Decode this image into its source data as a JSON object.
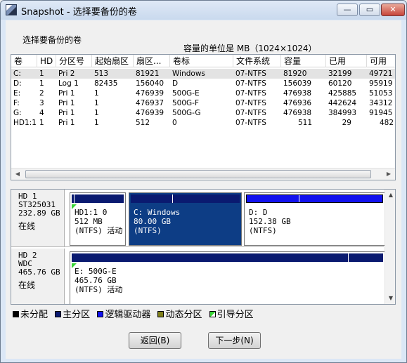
{
  "window": {
    "title": "Snapshot - 选择要备份的卷",
    "min_glyph": "—",
    "max_glyph": "▭",
    "close_glyph": "✕"
  },
  "labels": {
    "select_volume": "选择要备份的卷",
    "unit_note": "容量的单位是 MB（1024×1024）"
  },
  "columns": [
    "卷",
    "HD",
    "分区号",
    "起始扇区",
    "扇区...",
    "卷标",
    "文件系统",
    "容量",
    "已用",
    "可用"
  ],
  "rows": [
    {
      "vol": "C:",
      "hd": "1",
      "pno": "Pri  2",
      "start": "513",
      "sectors": "81921",
      "label": "Windows",
      "fs": "07-NTFS",
      "cap": "81920",
      "used": "32199",
      "free": "49721"
    },
    {
      "vol": "D:",
      "hd": "1",
      "pno": "Log  1",
      "start": "82435",
      "sectors": "156040",
      "label": "D",
      "fs": "07-NTFS",
      "cap": "156039",
      "used": "60120",
      "free": "95919"
    },
    {
      "vol": "E:",
      "hd": "2",
      "pno": "Pri  1",
      "start": "1",
      "sectors": "476939",
      "label": "500G-E",
      "fs": "07-NTFS",
      "cap": "476938",
      "used": "425885",
      "free": "51053"
    },
    {
      "vol": "F:",
      "hd": "3",
      "pno": "Pri  1",
      "start": "1",
      "sectors": "476937",
      "label": "500G-F",
      "fs": "07-NTFS",
      "cap": "476936",
      "used": "442624",
      "free": "34312"
    },
    {
      "vol": "G:",
      "hd": "4",
      "pno": "Pri  1",
      "start": "1",
      "sectors": "476939",
      "label": "500G-G",
      "fs": "07-NTFS",
      "cap": "476938",
      "used": "384993",
      "free": "91945"
    },
    {
      "vol": "HD1:1",
      "hd": "1",
      "pno": "Pri  1",
      "start": "1",
      "sectors": "512",
      "label": "0",
      "fs": "07-NTFS",
      "cap": "511",
      "used": "29",
      "free": "482"
    }
  ],
  "disks": [
    {
      "name": "HD  1",
      "model": "ST325031",
      "size": "232.89 GB",
      "status": "在线",
      "partitions": [
        {
          "line1": "HD1:1 0",
          "line2": "512 MB",
          "line3": "(NTFS) 活动",
          "used_fraction": 0.06,
          "type": "primary"
        },
        {
          "line1": "C: Windows",
          "line2": "80.00 GB",
          "line3": "(NTFS)",
          "used_fraction": 0.39,
          "type": "primary"
        },
        {
          "line1": "D: D",
          "line2": "152.38 GB",
          "line3": "(NTFS)",
          "used_fraction": 0.39,
          "type": "logical"
        }
      ]
    },
    {
      "name": "HD  2",
      "model": "WDC",
      "size": "465.76 GB",
      "status": "在线",
      "partitions": [
        {
          "line1": "E: 500G-E",
          "line2": "465.76 GB",
          "line3": "(NTFS) 活动",
          "used_fraction": 0.89,
          "type": "primary"
        }
      ]
    }
  ],
  "legend": [
    {
      "label": "未分配",
      "color": "#000000"
    },
    {
      "label": "主分区",
      "color": "#0a1a70"
    },
    {
      "label": "逻辑驱动器",
      "color": "#1212ee"
    },
    {
      "label": "动态分区",
      "color": "#7f7f1a"
    },
    {
      "label": "引导分区",
      "color": "#39d436"
    }
  ],
  "buttons": {
    "back": "返回(B)",
    "next": "下一步(N)"
  },
  "scroll": {
    "left": "◀",
    "right": "▶",
    "up": "▲",
    "down": "▼"
  }
}
